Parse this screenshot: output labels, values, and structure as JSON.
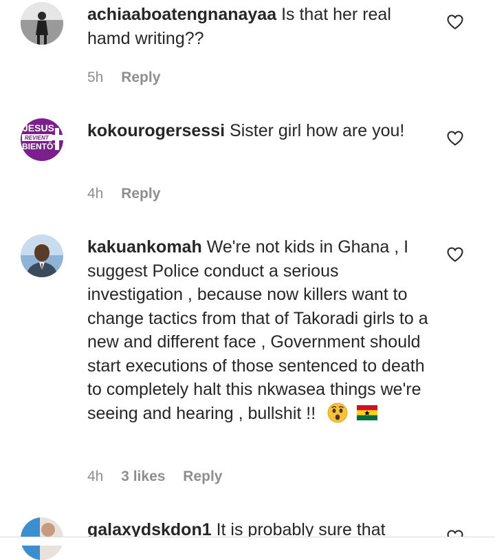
{
  "comments": [
    {
      "username": "achiaaboatengnanayaa",
      "text": "Is that her real hamd writing??",
      "time": "5h",
      "likes": "",
      "reply_label": "Reply",
      "avatar_icon": "user-photo-avatar"
    },
    {
      "username": "kokourogersessi",
      "text": "Sister girl how are you!",
      "time": "4h",
      "likes": "",
      "reply_label": "Reply",
      "avatar_icon": "jesus-revient-bientot-logo-avatar",
      "avatar_text": [
        "JESUS",
        "REVIENT",
        "BIENTÔT"
      ]
    },
    {
      "username": "kakuankomah",
      "text": "We're not kids in Ghana , I suggest Police conduct a serious investigation , because now killers want to change tactics from that of Takoradi girls to a new and different face , Government should start executions of those sentenced to death to completely halt this nkwasea things we're seeing and hearing , bullshit !!",
      "emojis": [
        "astonished-face-emoji",
        "ghana-flag-emoji"
      ],
      "time": "4h",
      "likes": "3 likes",
      "reply_label": "Reply",
      "avatar_icon": "user-photo-avatar"
    },
    {
      "username": "galaxydskdon1",
      "text": "It is probably sure that",
      "time": "",
      "reply_label": "",
      "avatar_icon": "user-photo-avatar"
    }
  ],
  "icons": {
    "like": "heart-outline-icon"
  },
  "colors": {
    "text": "#262626",
    "meta": "#8e8e8e",
    "background": "#ffffff"
  }
}
